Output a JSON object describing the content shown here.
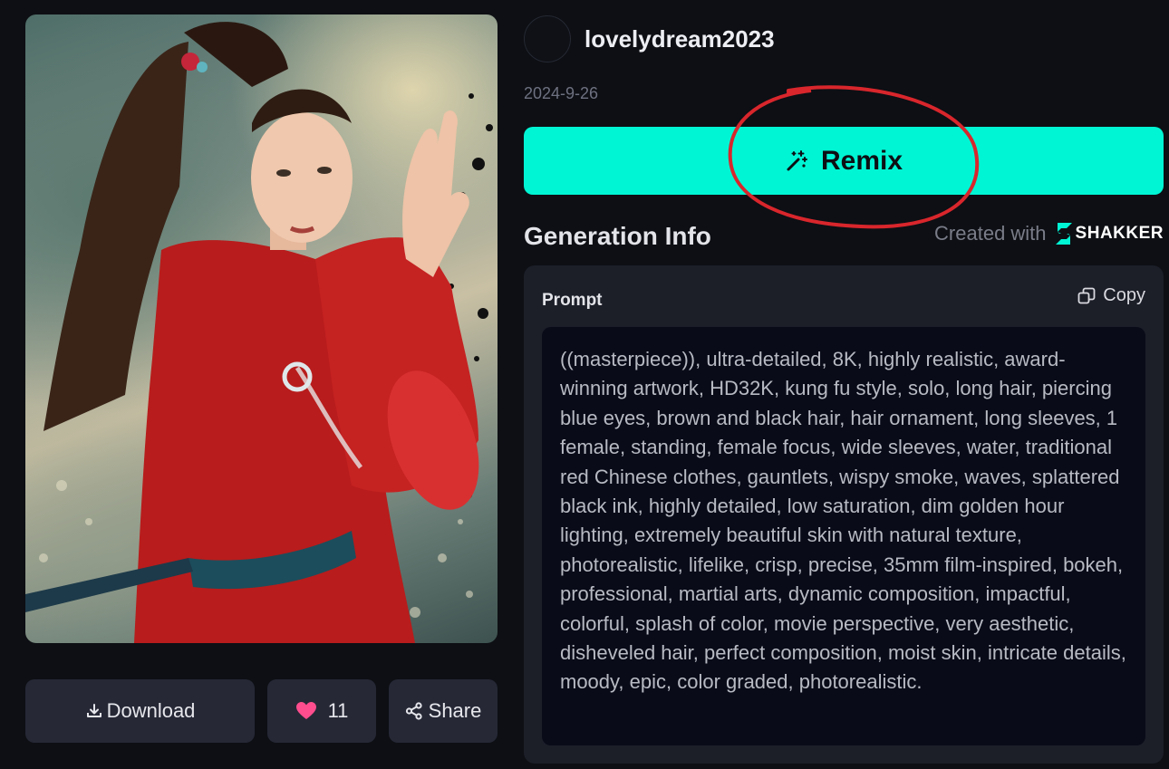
{
  "image": {
    "alt": ""
  },
  "actions": {
    "download_label": "Download",
    "like_count": "11",
    "share_label": "Share"
  },
  "author": {
    "username": "lovelydream2023",
    "date": "2024-9-26"
  },
  "remix": {
    "label": "Remix"
  },
  "generation_info": {
    "title": "Generation Info",
    "created_with": "Created with",
    "brand_name": "SHAKKER"
  },
  "prompt": {
    "label": "Prompt",
    "copy_label": "Copy",
    "text": "((masterpiece)), ultra-detailed, 8K, highly realistic, award-winning artwork, HD32K, kung fu style, solo, long hair, piercing blue eyes, brown and black hair, hair ornament, long sleeves, 1 female, standing, female focus, wide sleeves, water, traditional red Chinese clothes, gauntlets, wispy smoke, waves, splattered black ink, highly detailed, low saturation, dim golden hour lighting, extremely beautiful skin with natural texture, photorealistic, lifelike, crisp, precise, 35mm film-inspired, bokeh, professional, martial arts, dynamic composition, impactful, colorful, splash of color, movie perspective, very aesthetic, disheveled hair, perfect composition, moist skin, intricate details, moody, epic, color graded, photorealistic."
  },
  "colors": {
    "accent": "#00f5d4",
    "page_bg": "#0d0f14",
    "panel_bg": "#1c1e28",
    "annotation": "#d8262c",
    "heart": "#ff4d8d"
  },
  "icons": {
    "download": "download-icon",
    "like": "heart-icon",
    "share": "share-icon",
    "remix": "magic-wand-icon",
    "copy": "copy-icon",
    "brand": "shakker-logo"
  }
}
